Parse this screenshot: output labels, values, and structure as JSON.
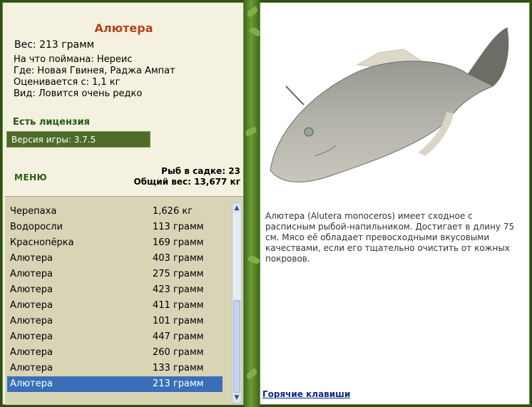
{
  "fish": {
    "name": "Алютера",
    "weight": "Вес: 213 грамм",
    "caught_on": "На что поймана: Нереис",
    "where": "Где: Новая Гвинея, Раджа Ампат",
    "valued": "Оценивается с: 1,1 кг",
    "rarity": "Вид: Ловится очень редко"
  },
  "license": "Есть лицензия",
  "version": "Версия игры: 3.7.5",
  "menu_label": "МЕНЮ",
  "cage": {
    "count": "Рыб в садке: 23",
    "total": "Общий вес: 13,677 кг"
  },
  "catch_list": [
    {
      "name": "Черепаха",
      "weight": "1,626 кг"
    },
    {
      "name": "Водоросли",
      "weight": "113 грамм"
    },
    {
      "name": "Краснопёрка",
      "weight": "169 грамм"
    },
    {
      "name": "Алютера",
      "weight": "403 грамм"
    },
    {
      "name": "Алютера",
      "weight": "275 грамм"
    },
    {
      "name": "Алютера",
      "weight": "423 грамм"
    },
    {
      "name": "Алютера",
      "weight": "411 грамм"
    },
    {
      "name": "Алютера",
      "weight": "101 грамм"
    },
    {
      "name": "Алютера",
      "weight": "447 грамм"
    },
    {
      "name": "Алютера",
      "weight": "260 грамм"
    },
    {
      "name": "Алютера",
      "weight": "133 грамм"
    },
    {
      "name": "Алютера",
      "weight": "213 грамм"
    }
  ],
  "selected_index": 11,
  "description": "Алютера (Alutera monoceros) имеет сходное с расписным рыбой-напильником. Достигает в длину 75 см. Мясо её обладает превосходными вкусовыми качествами, если его тщательно очистить от кожных покровов.",
  "hotkeys_link": "Горячие клавиши",
  "icons": {
    "scroll_up": "scroll-up-arrow-icon",
    "scroll_down": "scroll-down-arrow-icon"
  },
  "colors": {
    "title": "#b5431b",
    "selection": "#3a6fb8",
    "panel_bg": "#f4f1e0"
  }
}
